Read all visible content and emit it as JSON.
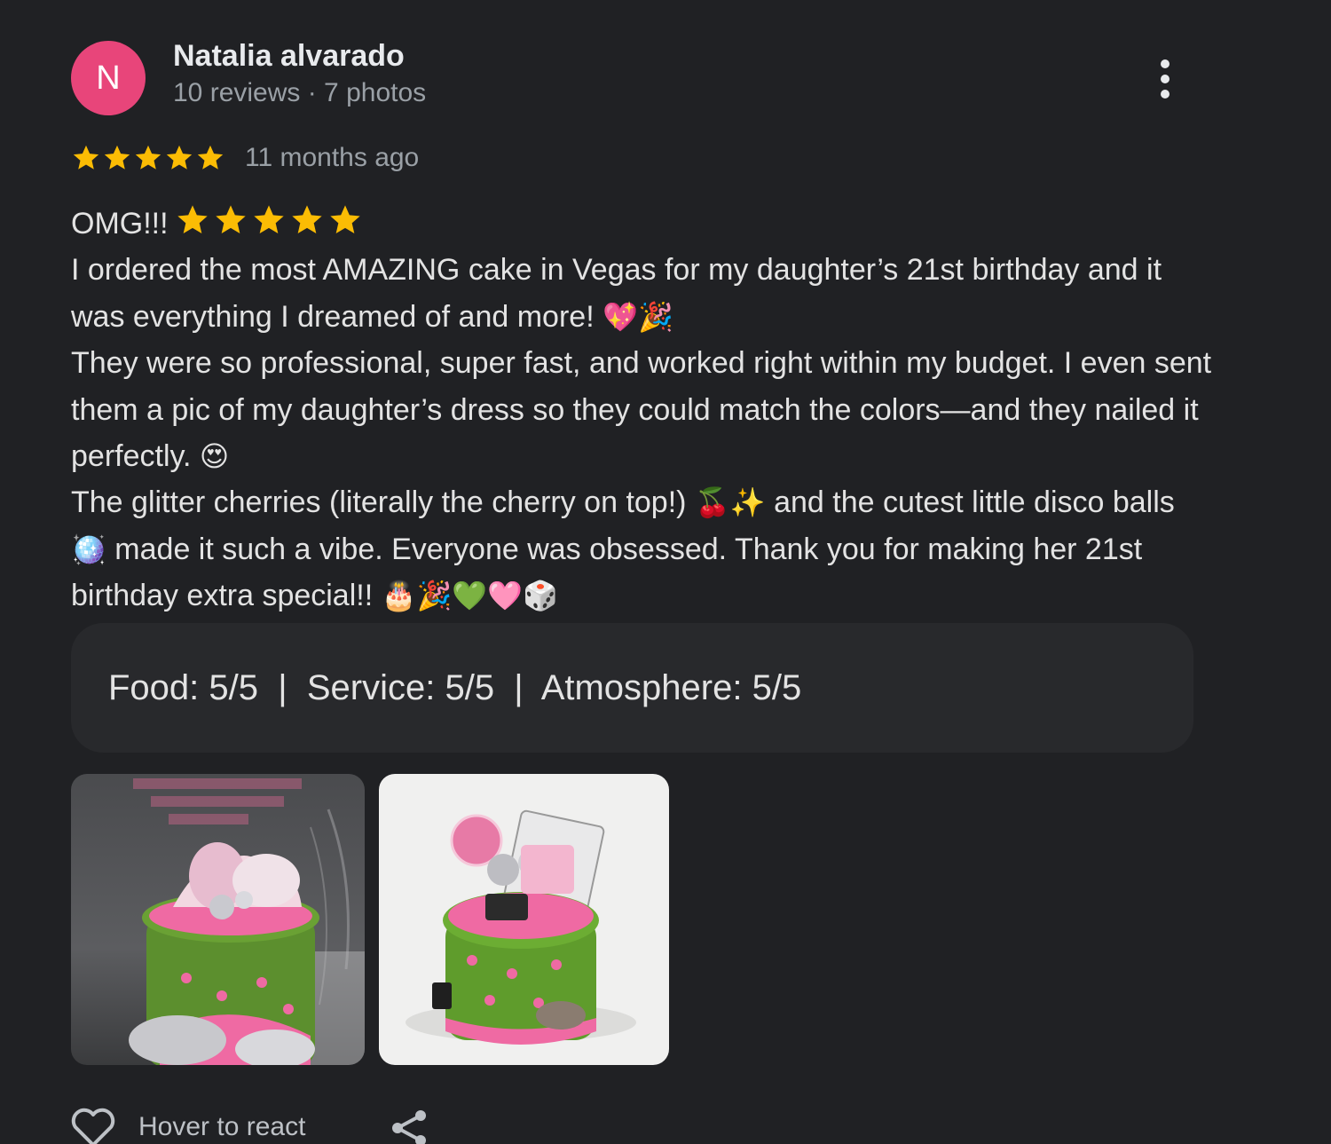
{
  "reviewer": {
    "initial": "N",
    "name": "Natalia alvarado",
    "meta": "10 reviews · 7 photos",
    "avatar_color": "#e8457a"
  },
  "rating": {
    "stars": 5,
    "max": 5,
    "time_ago": "11 months ago",
    "star_color": "#fbbc04"
  },
  "review": {
    "line1": "OMG!!!",
    "inline_stars": 5,
    "paragraph1": "I ordered the most AMAZING cake in Vegas for my daughter’s 21st birthday and it was everything I dreamed of and more!",
    "paragraph1_emoji": "💖🎉",
    "paragraph2": "They were so professional, super fast, and worked right within my budget. I even sent them a pic of my daughter’s dress so they could match the colors—and they nailed it perfectly.",
    "paragraph2_emoji": "😍",
    "paragraph3_a": "The glitter cherries (literally the cherry on top!)",
    "paragraph3_emoji_a": "🍒✨",
    "paragraph3_b": "and the cutest little disco balls",
    "paragraph3_emoji_b": "🪩",
    "paragraph3_c": "made it such a vibe. Everyone was obsessed. Thank you for making her 21st birthday extra special!!",
    "paragraph3_emoji_c": "🎂🎉💚🩷🎲"
  },
  "attributes": {
    "text": "Food: 5/5  |  Service: 5/5  |  Atmosphere: 5/5"
  },
  "photos": [
    {
      "description": "green cake with pink frosting and playing cards"
    },
    {
      "description": "green heart cake with disco balls and cards"
    }
  ],
  "actions": {
    "react_label": "Hover to react",
    "share_icon": "share-icon"
  },
  "colors": {
    "background": "#202124",
    "attributes_bg": "#28292c",
    "text": "#e3e3e3",
    "muted": "#9aa0a6"
  }
}
